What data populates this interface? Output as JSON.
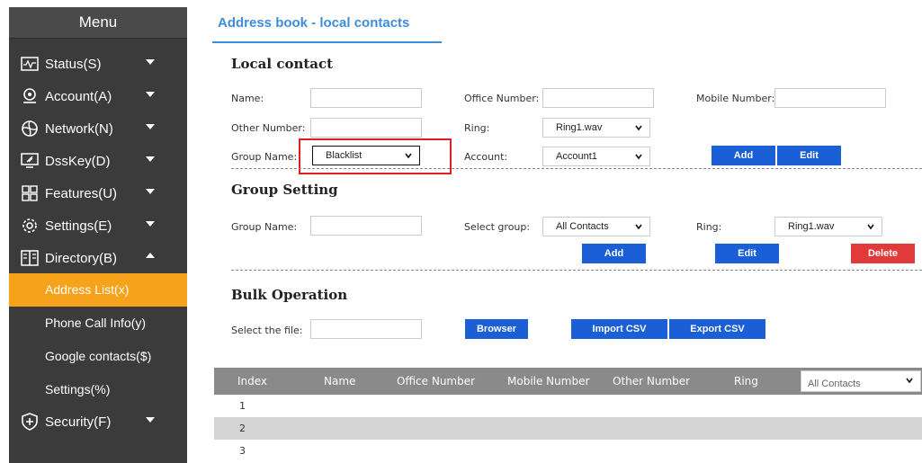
{
  "sidebar": {
    "title": "Menu",
    "items": [
      {
        "label": "Status(S)",
        "icon": "status-icon",
        "caret": "down"
      },
      {
        "label": "Account(A)",
        "icon": "account-icon",
        "caret": "down"
      },
      {
        "label": "Network(N)",
        "icon": "network-icon",
        "caret": "down"
      },
      {
        "label": "DssKey(D)",
        "icon": "dsskey-icon",
        "caret": "down"
      },
      {
        "label": "Features(U)",
        "icon": "features-icon",
        "caret": "down"
      },
      {
        "label": "Settings(E)",
        "icon": "settings-icon",
        "caret": "down"
      },
      {
        "label": "Directory(B)",
        "icon": "directory-icon",
        "caret": "up"
      }
    ],
    "sub_items": [
      {
        "label": "Address List(x)",
        "active": true
      },
      {
        "label": "Phone Call Info(y)",
        "active": false
      },
      {
        "label": "Google contacts($)",
        "active": false
      },
      {
        "label": "Settings(%)",
        "active": false
      }
    ],
    "security": {
      "label": "Security(F)",
      "icon": "shield-plus-icon",
      "caret": "down"
    },
    "active_color": "#f7a21b"
  },
  "main": {
    "tab": "Address book - local contacts",
    "local_contact": {
      "title": "Local contact",
      "name_label": "Name:",
      "office_label": "Office Number:",
      "mobile_label": "Mobile Number:",
      "other_label": "Other Number:",
      "ring_label": "Ring:",
      "ring_value": "Ring1.wav",
      "group_label": "Group Name:",
      "group_value": "Blacklist",
      "account_label": "Account:",
      "account_value": "Account1",
      "add": "Add",
      "edit": "Edit"
    },
    "group_setting": {
      "title": "Group Setting",
      "group_label": "Group Name:",
      "select_label": "Select group:",
      "select_value": "All Contacts",
      "ring_label": "Ring:",
      "ring_value": "Ring1.wav",
      "add": "Add",
      "edit": "Edit",
      "delete": "Delete"
    },
    "bulk": {
      "title": "Bulk Operation",
      "file_label": "Select the file:",
      "browser": "Browser",
      "import": "Import CSV",
      "export": "Export CSV"
    },
    "table": {
      "headers": [
        "Index",
        "Name",
        "Office Number",
        "Mobile Number",
        "Other Number",
        "Ring"
      ],
      "filter_value": "All Contacts",
      "rows": [
        "1",
        "2",
        "3"
      ]
    }
  },
  "colors": {
    "sidebar_bg": "#3b3b3b",
    "accent_blue": "#1a5fd6",
    "link_blue": "#3d8ddb",
    "delete_red": "#e23a3a",
    "highlight_red": "#e02020"
  }
}
